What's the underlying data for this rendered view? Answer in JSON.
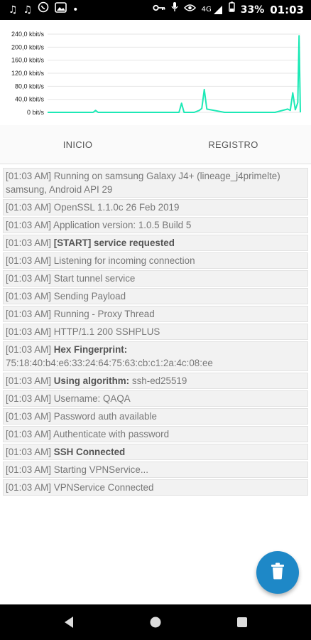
{
  "status_bar": {
    "left_icons": [
      "music-note-icon",
      "music-note-icon",
      "whatsapp-icon",
      "image-notification-icon",
      "dot-icon"
    ],
    "right_icons": [
      "key-icon",
      "microphone-icon",
      "eye-icon",
      "signal-icon",
      "battery-icon"
    ],
    "network": "4G",
    "battery": "33%",
    "time": "01:03"
  },
  "chart_data": {
    "type": "line",
    "ylim": [
      0,
      240
    ],
    "y_ticks": [
      "0 bit/s",
      "40,0 kbit/s",
      "80,0 kbit/s",
      "120,0 kbit/s",
      "160,0 kbit/s",
      "200,0 kbit/s",
      "240,0 kbit/s"
    ],
    "series": [
      {
        "color": "#1de9b6",
        "x": [
          0,
          5,
          10,
          15,
          18,
          19,
          20,
          25,
          30,
          35,
          40,
          45,
          50,
          52,
          53,
          54,
          58,
          60,
          61,
          62,
          63,
          70,
          80,
          90,
          95,
          96,
          97,
          98,
          99,
          99.5,
          100
        ],
        "values": [
          0,
          0,
          0,
          0,
          0,
          6,
          0,
          0,
          0,
          0,
          0,
          0,
          0,
          0,
          28,
          0,
          0,
          6,
          12,
          70,
          10,
          0,
          0,
          0,
          10,
          6,
          60,
          8,
          30,
          235,
          0
        ]
      }
    ]
  },
  "tabs": {
    "inicio": "INICIO",
    "registro": "REGISTRO"
  },
  "log": [
    {
      "time": "[01:03 AM]",
      "bold": "",
      "text": "Running on samsung Galaxy J4+ (lineage_j4primelte) samsung, Android API 29"
    },
    {
      "time": "[01:03 AM]",
      "bold": "",
      "text": "OpenSSL 1.1.0c 26 Feb 2019"
    },
    {
      "time": "[01:03 AM]",
      "bold": "",
      "text": "Application version: 1.0.5 Build 5"
    },
    {
      "time": "[01:03 AM]",
      "bold": "[START] service requested",
      "text": ""
    },
    {
      "time": "[01:03 AM]",
      "bold": "",
      "text": "Listening for incoming connection"
    },
    {
      "time": "[01:03 AM]",
      "bold": "",
      "text": "Start tunnel service"
    },
    {
      "time": "[01:03 AM]",
      "bold": "",
      "text": "Sending Payload"
    },
    {
      "time": "[01:03 AM]",
      "bold": "",
      "text": "Running - Proxy Thread"
    },
    {
      "time": "[01:03 AM]",
      "bold": "",
      "text": "HTTP/1.1 200 SSHPLUS"
    },
    {
      "time": "[01:03 AM]",
      "bold": "Hex Fingerprint:",
      "text": "75:18:40:b4:e6:33:24:64:75:63:cb:c1:2a:4c:08:ee"
    },
    {
      "time": "[01:03 AM]",
      "bold": "Using algorithm:",
      "text": "ssh-ed25519"
    },
    {
      "time": "[01:03 AM]",
      "bold": "",
      "text": "Username: QAQA"
    },
    {
      "time": "[01:03 AM]",
      "bold": "",
      "text": "Password auth available"
    },
    {
      "time": "[01:03 AM]",
      "bold": "",
      "text": "Authenticate with password"
    },
    {
      "time": "[01:03 AM]",
      "bold": "SSH Connected",
      "text": ""
    },
    {
      "time": "[01:03 AM]",
      "bold": "",
      "text": "Starting VPNService..."
    },
    {
      "time": "[01:03 AM]",
      "bold": "",
      "text": "VPNService Connected"
    }
  ],
  "fab": {
    "icon": "trash-icon",
    "color": "#1e88c7"
  },
  "nav": {
    "icons": [
      "back-icon",
      "home-icon",
      "recents-icon"
    ]
  }
}
